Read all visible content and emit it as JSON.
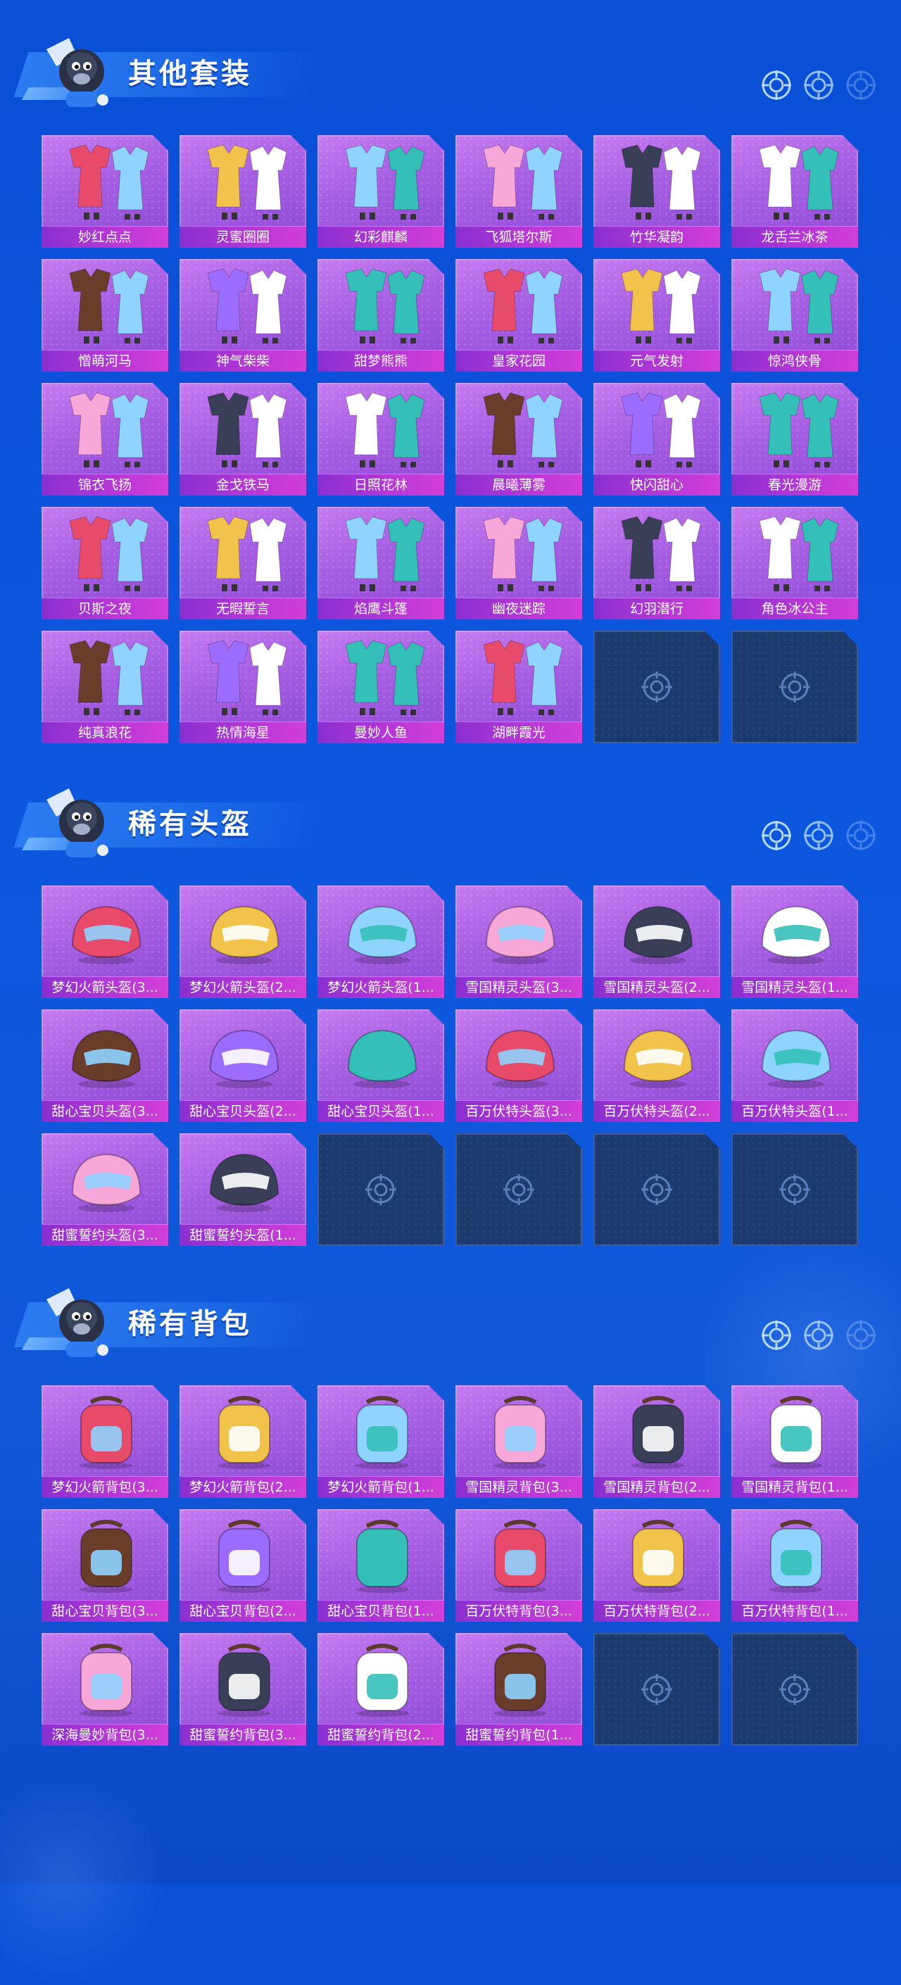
{
  "colors": {
    "background": "#0d57df",
    "card_purple": "#a65ee2",
    "label_magenta": "#b236d6",
    "empty_slot": "#1d3a6e"
  },
  "sections": [
    {
      "title": "其他套装",
      "icon": "mascot-icon",
      "items": [
        "妙红点点",
        "灵蜜圈圈",
        "幻彩麒麟",
        "飞狐塔尔斯",
        "竹华凝韵",
        "龙舌兰冰茶",
        "憎萌河马",
        "神气柴柴",
        "甜梦熊熊",
        "皇家花园",
        "元气发射",
        "惊鸿侠骨",
        "锦衣飞扬",
        "金戈铁马",
        "日照花林",
        "晨曦薄雾",
        "快闪甜心",
        "春光漫游",
        "贝斯之夜",
        "无暇誓言",
        "焰鹰斗篷",
        "幽夜迷踪",
        "幻羽潜行",
        "角色冰公主",
        "纯真浪花",
        "热情海星",
        "曼妙人鱼",
        "湖畔霞光"
      ],
      "empty_slots": 2
    },
    {
      "title": "稀有头盔",
      "icon": "mascot-icon",
      "items": [
        "梦幻火箭头盔(3...",
        "梦幻火箭头盔(2...",
        "梦幻火箭头盔(1...",
        "雪国精灵头盔(3...",
        "雪国精灵头盔(2...",
        "雪国精灵头盔(1...",
        "甜心宝贝头盔(3...",
        "甜心宝贝头盔(2...",
        "甜心宝贝头盔(1...",
        "百万伏特头盔(3...",
        "百万伏特头盔(2...",
        "百万伏特头盔(1...",
        "甜蜜誓约头盔(3...",
        "甜蜜誓约头盔(1..."
      ],
      "empty_slots": 4
    },
    {
      "title": "稀有背包",
      "icon": "mascot-icon",
      "items": [
        "梦幻火箭背包(3...",
        "梦幻火箭背包(2...",
        "梦幻火箭背包(1...",
        "雪国精灵背包(3...",
        "雪国精灵背包(2...",
        "雪国精灵背包(1...",
        "甜心宝贝背包(3...",
        "甜心宝贝背包(2...",
        "甜心宝贝背包(1...",
        "百万伏特背包(3...",
        "百万伏特背包(2...",
        "百万伏特背包(1...",
        "深海曼妙背包(3...",
        "甜蜜誓约背包(3...",
        "甜蜜誓约背包(2...",
        "甜蜜誓约背包(1..."
      ],
      "empty_slots": 2
    }
  ]
}
